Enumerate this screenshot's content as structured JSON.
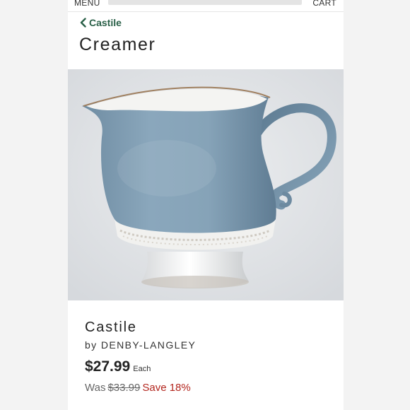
{
  "header": {
    "menu_label": "MENU",
    "cart_label": "CART"
  },
  "breadcrumb": {
    "back_label": "Castile"
  },
  "page": {
    "title": "Creamer"
  },
  "product": {
    "pattern": "Castile",
    "maker": "by DENBY-LANGLEY",
    "price": "$27.99",
    "price_unit": "Each",
    "was_label": "Was",
    "was_price": "$33.99",
    "save_text": "Save 18%"
  },
  "colors": {
    "accent_green": "#2a6048",
    "sale_red": "#b3261e",
    "glaze_blue": "#7f9db3"
  },
  "icons": {
    "back": "chevron-left-icon"
  }
}
